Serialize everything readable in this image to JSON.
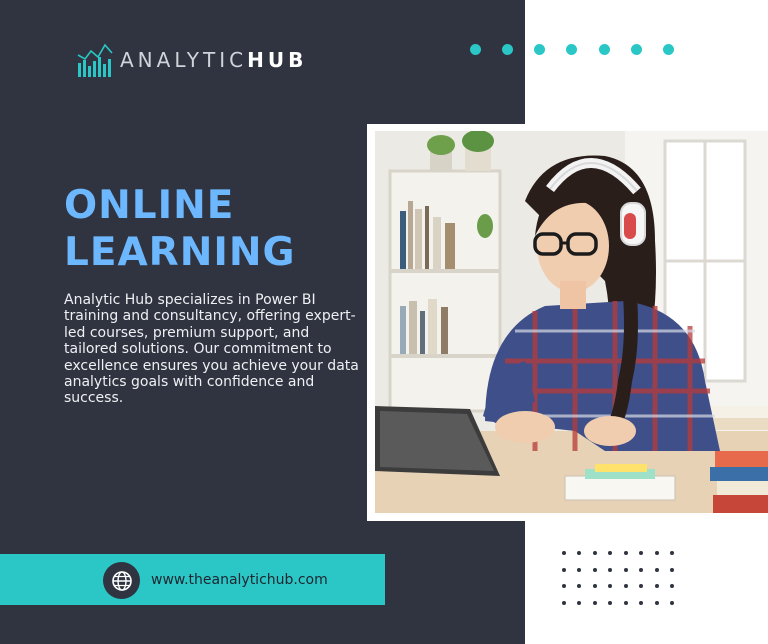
{
  "brand": {
    "logo_text_regular": "ANALYTIC",
    "logo_text_bold": "HUB",
    "logo_icon": "bar-chart-logo-icon"
  },
  "hero": {
    "title_line1": "ONLINE",
    "title_line2": "LEARNING",
    "description": "Analytic Hub specializes in Power BI training and consultancy, offering expert-led courses, premium support, and tailored solutions. Our commitment to excellence ensures you achieve your data analytics goals with confidence and success."
  },
  "footer": {
    "url": "www.theanalytichub.com",
    "url_icon": "globe-icon"
  },
  "image": {
    "subject": "photo-student-with-headphones"
  },
  "colors": {
    "panel": "#2f3440",
    "accent_teal": "#2ac7c6",
    "headline_blue": "#6db7ff",
    "background": "#ffffff"
  }
}
